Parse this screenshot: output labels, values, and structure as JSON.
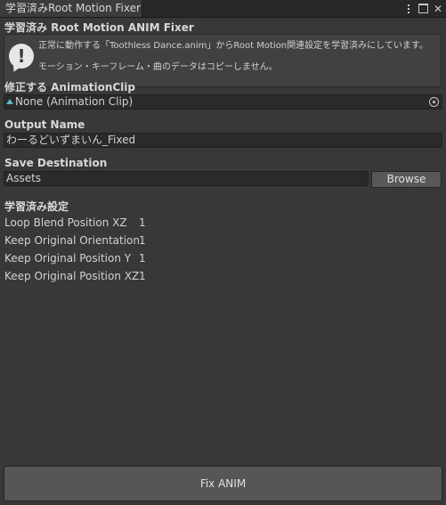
{
  "window": {
    "tab_title": "学習済みRoot Motion Fixer"
  },
  "header": {
    "title": "学習済み Root Motion ANIM Fixer"
  },
  "helpbox": {
    "line1": "正常に動作する「Toothless Dance.anim」からRoot Motion関連設定を学習済みにしています。",
    "line2": "モーション・キーフレーム・曲のデータはコピーしません。",
    "icon": "info-exclamation-icon"
  },
  "clip": {
    "label": "修正する AnimationClip",
    "value": "None (Animation Clip)"
  },
  "output": {
    "label": "Output Name",
    "value": "わーるどいずまいん_Fixed"
  },
  "save": {
    "label": "Save Destination",
    "value": "Assets",
    "browse_label": "Browse"
  },
  "settings": {
    "heading": "学習済み設定",
    "rows": [
      {
        "name": "Loop Blend Position XZ",
        "value": "1"
      },
      {
        "name": "Keep Original Orientation",
        "value": "1"
      },
      {
        "name": "Keep Original Position Y",
        "value": "1"
      },
      {
        "name": "Keep Original Position XZ",
        "value": "1"
      }
    ]
  },
  "footer": {
    "fix_label": "Fix ANIM"
  },
  "colors": {
    "background": "#383838",
    "field": "#2a2a2a",
    "button": "#565656",
    "clip_icon": "#5fb8c8"
  }
}
